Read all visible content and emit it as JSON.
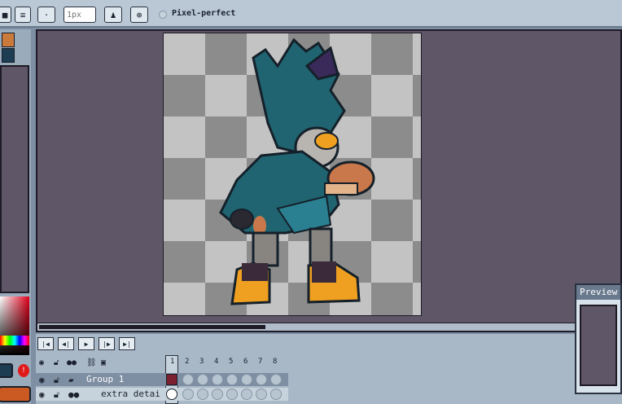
{
  "toolbar": {
    "brush_size_placeholder": "1px",
    "pixel_perfect_label": "Pixel-perfect"
  },
  "palette": {
    "colors": [
      "#ca7a3a",
      "#1c3d52"
    ]
  },
  "playback": {
    "buttons": [
      "|◀",
      "◀|",
      "▶",
      "|▶",
      "▶|"
    ]
  },
  "layers": {
    "header_icons": [
      "eye-icon",
      "lock-icon",
      "onion-skin-icon",
      "link-icon",
      "frame-icon"
    ],
    "rows": [
      {
        "name": "Group 1",
        "type": "group"
      },
      {
        "name": "extra detai",
        "type": "layer"
      }
    ]
  },
  "frames": [
    "1",
    "2",
    "3",
    "4",
    "5",
    "6",
    "7",
    "8"
  ],
  "preview": {
    "title": "Preview"
  },
  "colors": {
    "workspace_bg": "#5f5668",
    "ui_bg": "#a9b8c6",
    "accent_selected": "#7a2030",
    "primary_color": "#ca5a22"
  }
}
